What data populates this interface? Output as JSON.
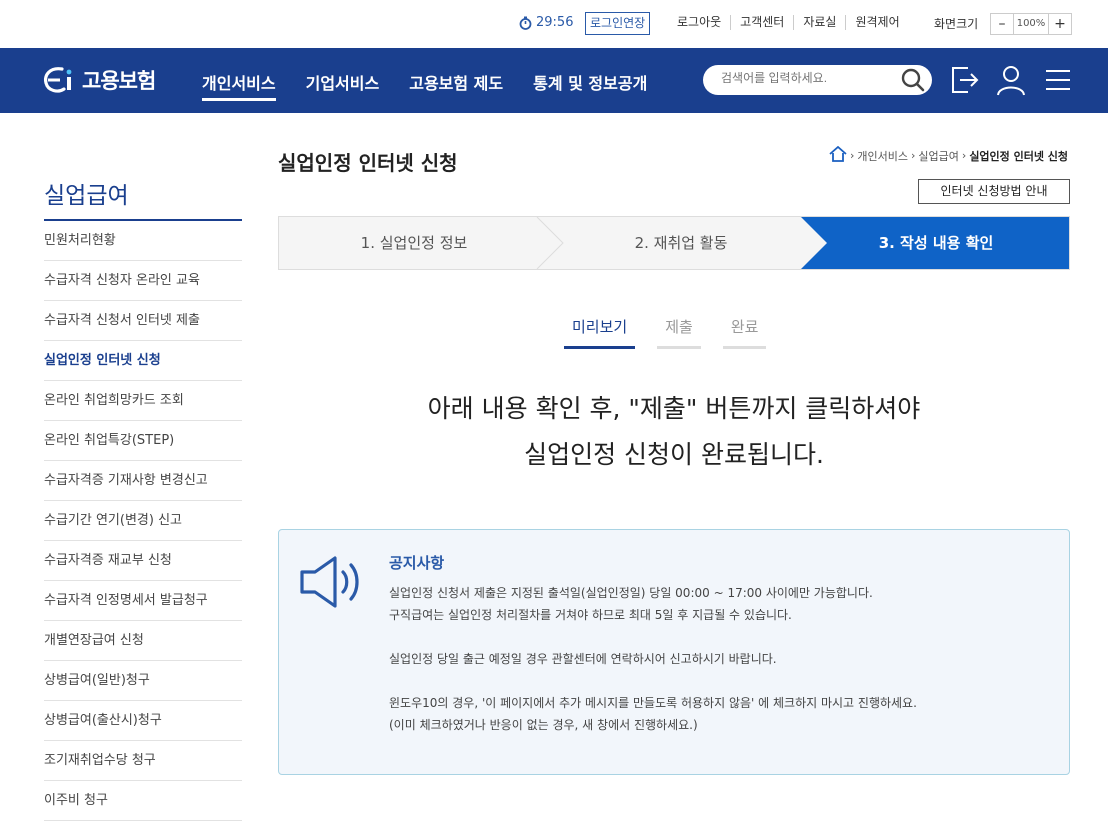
{
  "util": {
    "timer": "29:56",
    "extend_label": "로그인연장",
    "links": [
      "로그아웃",
      "고객센터",
      "자료실",
      "원격제어"
    ],
    "zoom_label": "화면크기",
    "zoom_minus": "–",
    "zoom_value": "100%",
    "zoom_plus": "+"
  },
  "header": {
    "logo_text": "고용보험",
    "menu": [
      "개인서비스",
      "기업서비스",
      "고용보험 제도",
      "통계 및 정보공개"
    ],
    "search_placeholder": "검색어를 입력하세요.",
    "icons": [
      "search-icon",
      "logout-icon",
      "user-icon",
      "menu-icon"
    ]
  },
  "sidebar": {
    "title": "실업급여",
    "items": [
      "민원처리현황",
      "수급자격 신청자 온라인 교육",
      "수급자격 신청서 인터넷 제출",
      "실업인정 인터넷 신청",
      "온라인 취업희망카드 조회",
      "온라인 취업특강(STEP)",
      "수급자격증 기재사항 변경신고",
      "수급기간 연기(변경) 신고",
      "수급자격증 재교부 신청",
      "수급자격 인정명세서 발급청구",
      "개별연장급여 신청",
      "상병급여(일반)청구",
      "상병급여(출산시)청구",
      "조기재취업수당 청구",
      "이주비 청구"
    ],
    "active_index": 3
  },
  "page": {
    "title": "실업인정 인터넷 신청",
    "breadcrumb": [
      "개인서비스",
      "실업급여",
      "실업인정 인터넷 신청"
    ],
    "guide_button": "인터넷 신청방법 안내"
  },
  "steps": [
    "1. 실업인정 정보",
    "2. 재취업 활동",
    "3. 작성 내용 확인"
  ],
  "tabs": [
    "미리보기",
    "제출",
    "완료"
  ],
  "message": [
    "아래 내용 확인 후, \"제출\" 버튼까지 클릭하셔야",
    "실업인정 신청이 완료됩니다."
  ],
  "notice": {
    "title": "공지사항",
    "lines": [
      "실업인정 신청서 제출은 지정된 출석일(실업인정일) 당일 00:00 ~ 17:00 사이에만 가능합니다.",
      "구직급여는 실업인정 처리절차를 거쳐야 하므로 최대 5일 후 지급될 수 있습니다.",
      "",
      "실업인정 당일 출근 예정일 경우 관할센터에 연락하시어 신고하시기 바랍니다.",
      "",
      "윈도우10의 경우, '이 페이지에서 추가 메시지를 만들도록 허용하지 않음' 에 체크하지 마시고 진행하세요.",
      "(이미 체크하였거나 반응이 없는 경우, 새 창에서 진행하세요.)"
    ]
  },
  "colors": {
    "brand": "#1a3f8e",
    "step_active": "#0f63c7",
    "notice_bg": "#f2f6fb",
    "notice_border": "#a9d3e3"
  }
}
